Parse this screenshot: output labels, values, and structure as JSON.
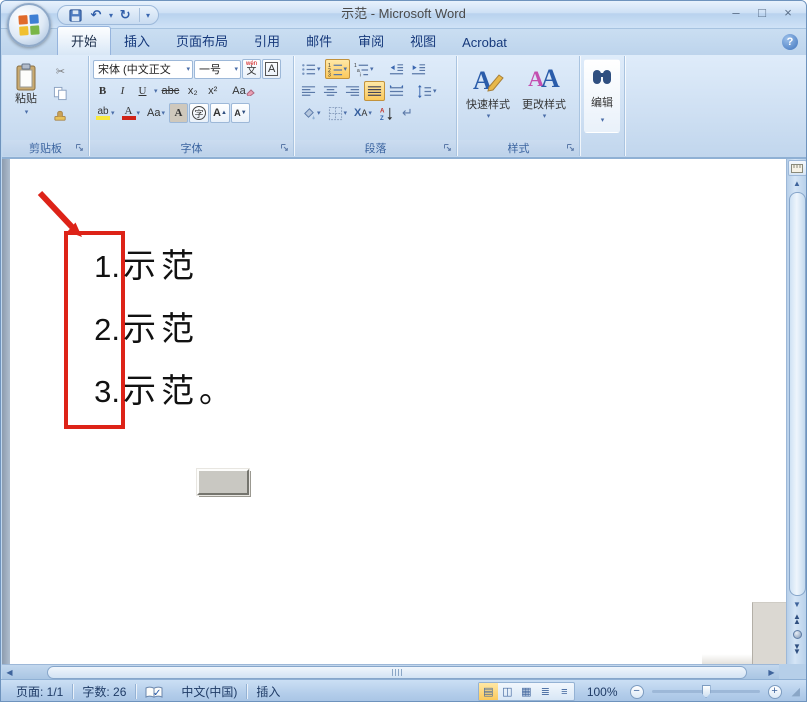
{
  "window": {
    "title": "示范 - Microsoft Word",
    "controls": {
      "minimize": "–",
      "maximize": "□",
      "close": "×"
    }
  },
  "qat": {
    "undo": "↶",
    "redo": "↻",
    "more": "▾"
  },
  "tabs": [
    {
      "label": "开始",
      "active": true
    },
    {
      "label": "插入"
    },
    {
      "label": "页面布局"
    },
    {
      "label": "引用"
    },
    {
      "label": "邮件"
    },
    {
      "label": "审阅"
    },
    {
      "label": "视图"
    },
    {
      "label": "Acrobat"
    }
  ],
  "help_label": "?",
  "icons": {
    "caret": "▾",
    "scissors": "✂",
    "check": "✓",
    "up_arrow": "▲",
    "down_arrow": "▼",
    "left_arrow": "◀",
    "right_arrow": "▶",
    "return_mark": "↵",
    "grip": "◢"
  },
  "ribbon": {
    "clipboard": {
      "label": "剪贴板",
      "paste_label": "粘贴"
    },
    "font": {
      "label": "字体",
      "font_name": "宋体 (中文正文",
      "font_size": "一号",
      "phonetic_pinyin": "wén",
      "phonetic": "文",
      "char_border": "A",
      "bold": "B",
      "italic": "I",
      "underline": "U",
      "strikethrough": "abc",
      "subscript": "x₂",
      "superscript": "x²",
      "clear_formatting": "Aa",
      "highlight": "ab",
      "font_color": "A",
      "change_case": "Aa",
      "char_shading": "A",
      "enclose": "字",
      "grow_font": "A",
      "shrink_font": "A"
    },
    "paragraph": {
      "label": "段落",
      "asian_x": "X",
      "asian_a": "A"
    },
    "styles": {
      "label": "样式",
      "quick_styles": "快速样式",
      "change_styles": "更改样式"
    },
    "editing": {
      "label": "编辑"
    }
  },
  "document": {
    "list_items": [
      {
        "number": "1.",
        "text": "示范"
      },
      {
        "number": "2.",
        "text": "示范"
      },
      {
        "number": "3.",
        "text": "示范。"
      }
    ]
  },
  "status": {
    "page": "页面: 1/1",
    "words": "字数: 26",
    "language": "中文(中国)",
    "mode": "插入",
    "zoom": "100%",
    "zoom_out": "−",
    "zoom_in": "+"
  },
  "colors": {
    "annotation_red": "#dd2318",
    "highlight_orange": "#fbc95c"
  }
}
